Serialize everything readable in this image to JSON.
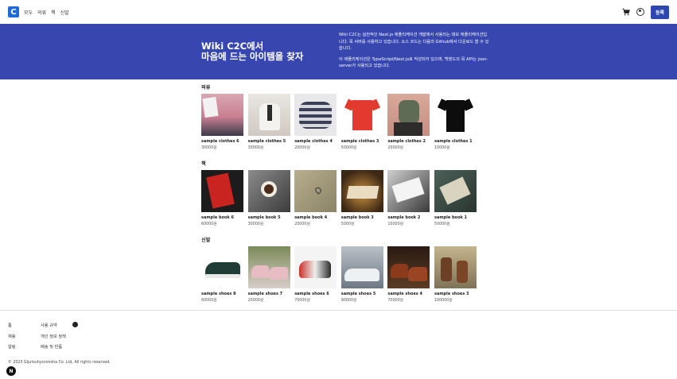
{
  "header": {
    "logo_letter": "C",
    "nav": [
      "모두",
      "의류",
      "책",
      "신발"
    ],
    "register_label": "등록",
    "icons": [
      "cart-icon",
      "user-icon"
    ]
  },
  "hero": {
    "title_line1": "Wiki C2C에서",
    "title_line2": "마음에 드는 아이템을 찾자",
    "desc1": "Wiki C2C는 실전적인 Next.js 애플리케이션 개발에서 사용되는 데모 애플리케이션입니다. 목 서버를 사용하고 있습니다. 소스 코드는 다음의 Github에서 다운로드 할 수 있습니다.",
    "desc2": "이 애플리케이션은 TypeScript/Next.js로 작성되어 있으며, 백엔드의 목 API는 json-server가 사용되고 있습니다.",
    "background": "#3847b0"
  },
  "sections": [
    {
      "title": "의류",
      "items": [
        {
          "name": "sample clothes 6",
          "price": "30000원"
        },
        {
          "name": "sample clothes 5",
          "price": "30000원"
        },
        {
          "name": "sample clothes 4",
          "price": "20000원"
        },
        {
          "name": "sample clothes 3",
          "price": "50000원"
        },
        {
          "name": "sample clothes 2",
          "price": "20000원"
        },
        {
          "name": "sample clothes 1",
          "price": "10000원"
        }
      ]
    },
    {
      "title": "책",
      "items": [
        {
          "name": "sample book 6",
          "price": "60000원"
        },
        {
          "name": "sample book 5",
          "price": "30000원"
        },
        {
          "name": "sample book 4",
          "price": "20000원"
        },
        {
          "name": "sample book 3",
          "price": "5000원"
        },
        {
          "name": "sample book 2",
          "price": "10000원"
        },
        {
          "name": "sample book 1",
          "price": "50000원"
        }
      ]
    },
    {
      "title": "신발",
      "items": [
        {
          "name": "sample shoes 8",
          "price": "60000원"
        },
        {
          "name": "sample shoes 7",
          "price": "20000원"
        },
        {
          "name": "sample shoes 6",
          "price": "70000원"
        },
        {
          "name": "sample shoes 5",
          "price": "90000원"
        },
        {
          "name": "sample shoes 4",
          "price": "70000원"
        },
        {
          "name": "sample shoes 3",
          "price": "100000원"
        }
      ]
    }
  ],
  "footer": {
    "col1": [
      "톱",
      "채용",
      "알림"
    ],
    "col2": [
      "사용 규약",
      "개인 정보 정책",
      "배송 및 반품"
    ],
    "copyright": "© 2023 Gijutsuhyoronsha Co. Ltd, All rights reserved.",
    "floating_letter": "N"
  }
}
